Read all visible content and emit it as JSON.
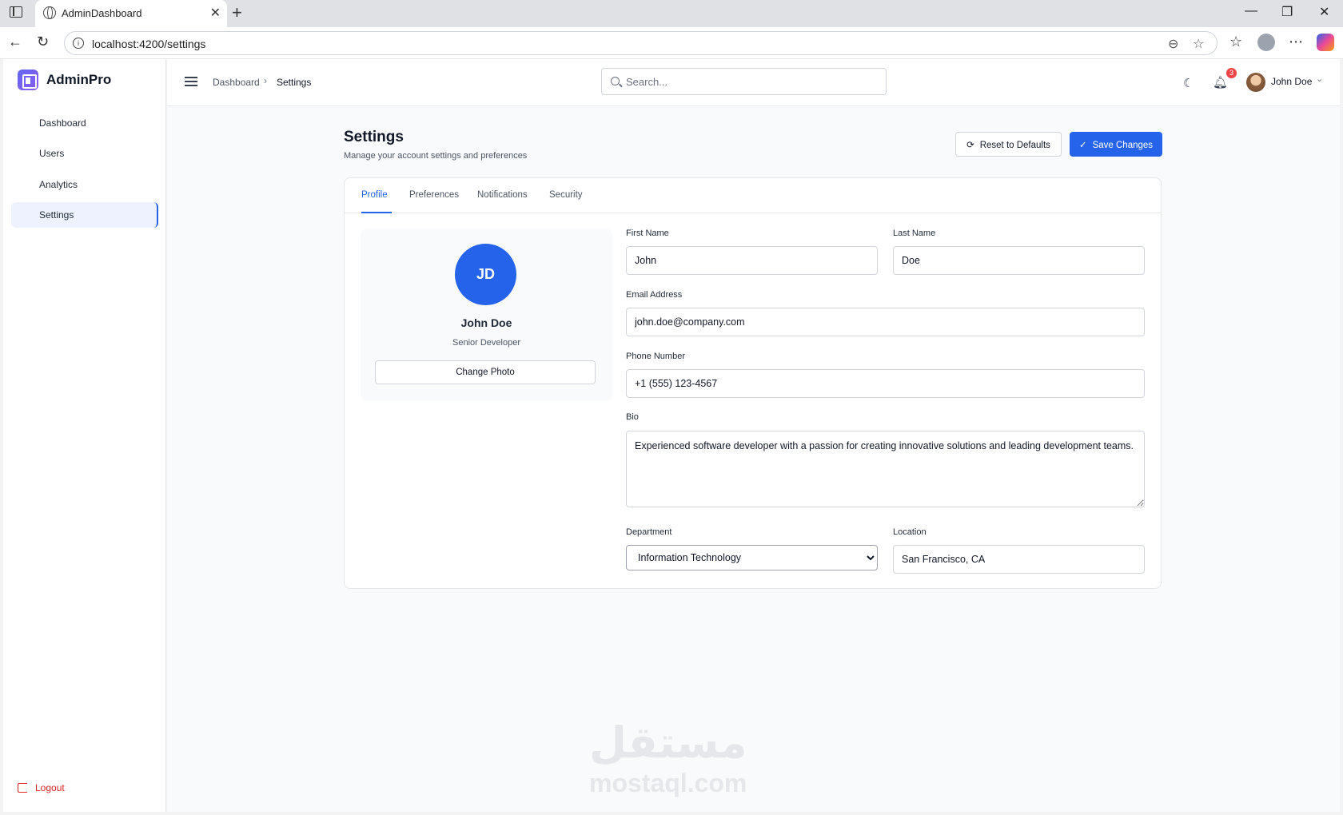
{
  "browser": {
    "tab_title": "AdminDashboard",
    "url": "localhost:4200/settings"
  },
  "app": {
    "name": "AdminPro"
  },
  "sidebar": {
    "items": [
      {
        "label": "Dashboard",
        "active": false
      },
      {
        "label": "Users",
        "active": false
      },
      {
        "label": "Analytics",
        "active": false
      },
      {
        "label": "Settings",
        "active": true
      }
    ],
    "logout_label": "Logout"
  },
  "topbar": {
    "breadcrumb": {
      "home": "Dashboard",
      "current": "Settings"
    },
    "search_placeholder": "Search...",
    "notification_count": "3",
    "user_name": "John Doe"
  },
  "page": {
    "title": "Settings",
    "subtitle": "Manage your account settings and preferences",
    "reset_label": "Reset to Defaults",
    "save_label": "Save Changes"
  },
  "tabs": [
    {
      "label": "Profile",
      "active": true
    },
    {
      "label": "Preferences",
      "active": false
    },
    {
      "label": "Notifications",
      "active": false
    },
    {
      "label": "Security",
      "active": false
    }
  ],
  "profile": {
    "initials": "JD",
    "name": "John Doe",
    "role": "Senior Developer",
    "change_photo_label": "Change Photo"
  },
  "form": {
    "first_name": {
      "label": "First Name",
      "value": "John"
    },
    "last_name": {
      "label": "Last Name",
      "value": "Doe"
    },
    "email": {
      "label": "Email Address",
      "value": "john.doe@company.com"
    },
    "phone": {
      "label": "Phone Number",
      "value": "+1 (555) 123-4567"
    },
    "bio": {
      "label": "Bio",
      "value": "Experienced software developer with a passion for creating innovative solutions and leading development teams."
    },
    "department": {
      "label": "Department",
      "value": "Information Technology"
    },
    "location": {
      "label": "Location",
      "value": "San Francisco, CA"
    }
  },
  "watermark": {
    "arabic": "مستقل",
    "latin": "mostaql.com"
  },
  "colors": {
    "accent": "#2563eb",
    "danger": "#dc2626",
    "badge": "#ef4444"
  }
}
